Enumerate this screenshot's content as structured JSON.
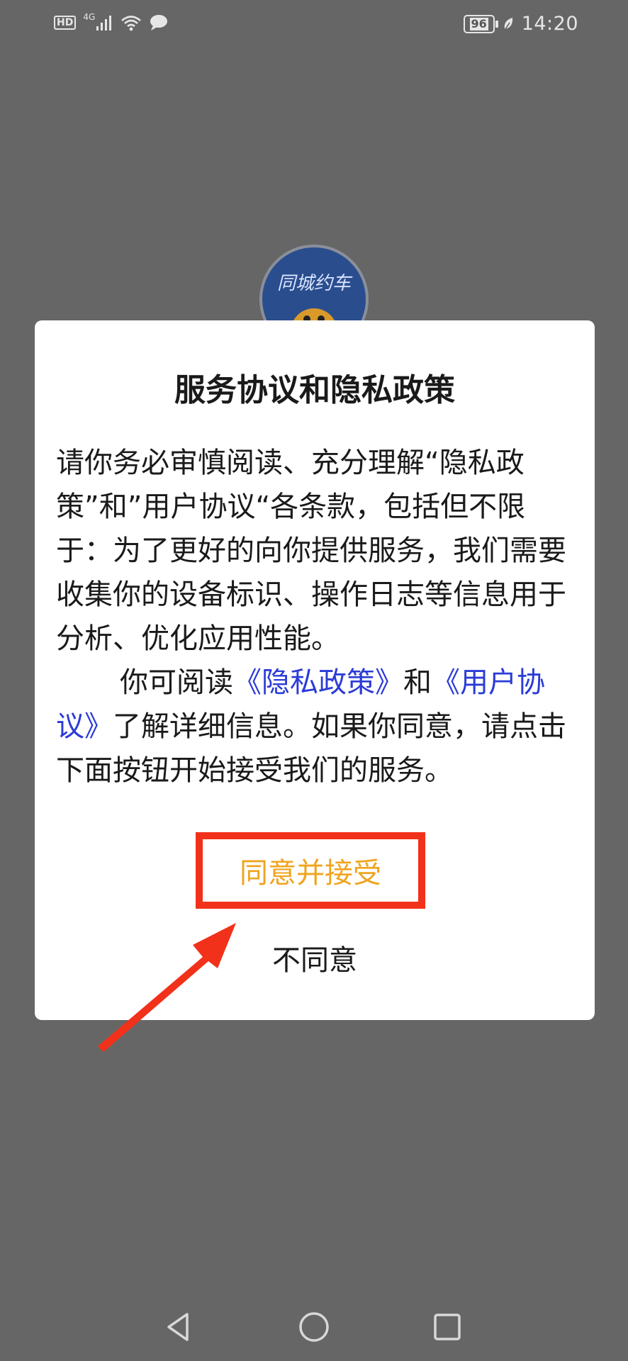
{
  "status_bar": {
    "left_icons": [
      "hd-icon",
      "signal-icon",
      "wifi-icon",
      "message-icon"
    ],
    "hd_label": "HD",
    "network_label": "4G",
    "battery_level": "96",
    "time": "14:20"
  },
  "logo": {
    "text": "同城约车"
  },
  "dialog": {
    "title": "服务协议和隐私政策",
    "paragraph1": "请你务必审慎阅读、充分理解“隐私政策”和”用户协议“各条款，包括但不限于：为了更好的向你提供服务，我们需要收集你的设备标识、操作日志等信息用于分析、优化应用性能。",
    "para2_prefix": "你可阅读",
    "privacy_link": "《隐私政策》",
    "para2_and": "和",
    "terms_link": "《用户协议》",
    "para2_suffix": "了解详细信息。如果你同意，请点击下面按钮开始接受我们的服务。",
    "agree_label": "同意并接受",
    "disagree_label": "不同意"
  },
  "colors": {
    "overlay": "#666666",
    "link": "#2b3bd6",
    "agree_text": "#f0a41e",
    "highlight": "#f2311a"
  },
  "nav_bar": {
    "icons": [
      "back-icon",
      "home-icon",
      "recents-icon"
    ]
  }
}
